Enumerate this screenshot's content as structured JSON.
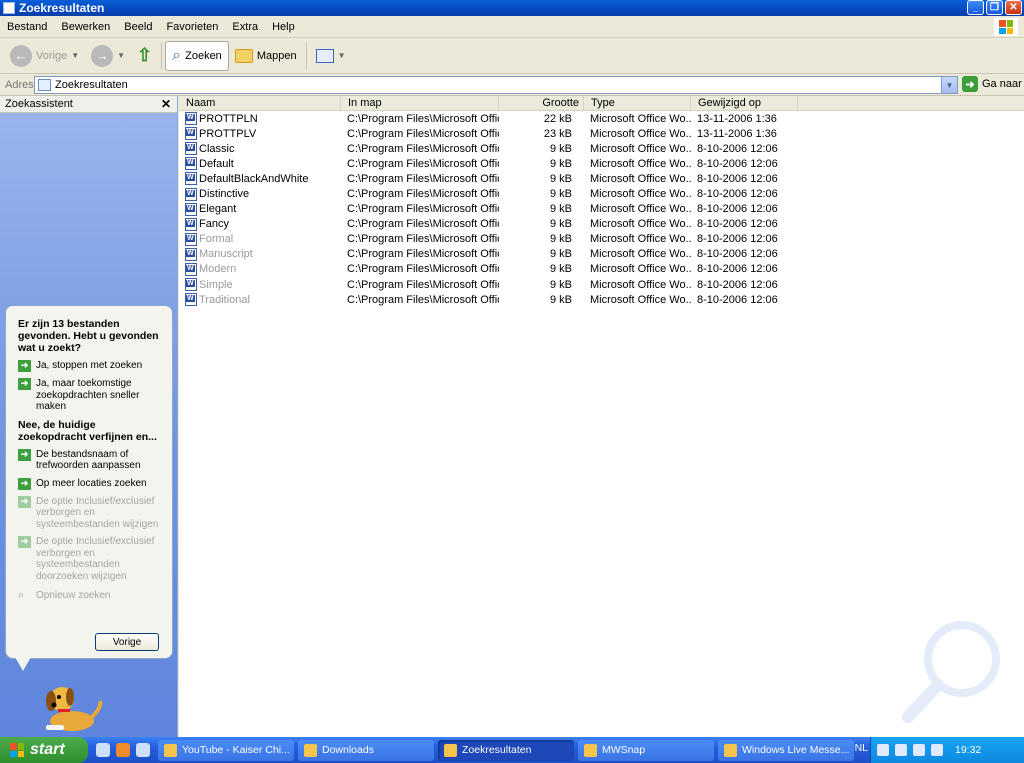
{
  "window": {
    "title": "Zoekresultaten",
    "controls": [
      "minimize",
      "maximize",
      "close"
    ]
  },
  "menu": [
    "Bestand",
    "Bewerken",
    "Beeld",
    "Favorieten",
    "Extra",
    "Help"
  ],
  "toolbar": {
    "back_label": "Vorige",
    "search_label": "Zoeken",
    "folders_label": "Mappen"
  },
  "address": {
    "label": "Adres",
    "value": "Zoekresultaten",
    "go_label": "Ga naar"
  },
  "left_pane": {
    "title": "Zoekassistent",
    "question": "Er zijn 13 bestanden gevonden. Hebt u gevonden wat u zoekt?",
    "options_yes": [
      {
        "text": "Ja, stoppen met zoeken",
        "enabled": true
      },
      {
        "text": "Ja, maar toekomstige zoekopdrachten sneller maken",
        "enabled": true
      }
    ],
    "refine_heading": "Nee, de huidige zoekopdracht verfijnen en...",
    "options_refine": [
      {
        "text": "De bestandsnaam of trefwoorden aanpassen",
        "enabled": true
      },
      {
        "text": "Op meer locaties zoeken",
        "enabled": true
      },
      {
        "text": "De optie Inclusief/exclusief verborgen en systeembestanden wijzigen",
        "enabled": false
      },
      {
        "text": "De optie Inclusief/exclusief verborgen en systeembestanden doorzoeken wijzigen",
        "enabled": false
      }
    ],
    "new_search": "Opnieuw zoeken",
    "back_button": "Vorige"
  },
  "list": {
    "columns": [
      "Naam",
      "In map",
      "Grootte",
      "Type",
      "Gewijzigd op"
    ],
    "rows": [
      {
        "name": "PROTTPLN",
        "folder": "C:\\Program Files\\Microsoft Offic...",
        "size": "22 kB",
        "type": "Microsoft Office Wo...",
        "modified": "13-11-2006 1:36",
        "faded": false
      },
      {
        "name": "PROTTPLV",
        "folder": "C:\\Program Files\\Microsoft Offic...",
        "size": "23 kB",
        "type": "Microsoft Office Wo...",
        "modified": "13-11-2006 1:36",
        "faded": false
      },
      {
        "name": "Classic",
        "folder": "C:\\Program Files\\Microsoft Offic...",
        "size": "9 kB",
        "type": "Microsoft Office Wo...",
        "modified": "8-10-2006 12:06",
        "faded": false
      },
      {
        "name": "Default",
        "folder": "C:\\Program Files\\Microsoft Offic...",
        "size": "9 kB",
        "type": "Microsoft Office Wo...",
        "modified": "8-10-2006 12:06",
        "faded": false
      },
      {
        "name": "DefaultBlackAndWhite",
        "folder": "C:\\Program Files\\Microsoft Offic...",
        "size": "9 kB",
        "type": "Microsoft Office Wo...",
        "modified": "8-10-2006 12:06",
        "faded": false
      },
      {
        "name": "Distinctive",
        "folder": "C:\\Program Files\\Microsoft Offic...",
        "size": "9 kB",
        "type": "Microsoft Office Wo...",
        "modified": "8-10-2006 12:06",
        "faded": false
      },
      {
        "name": "Elegant",
        "folder": "C:\\Program Files\\Microsoft Offic...",
        "size": "9 kB",
        "type": "Microsoft Office Wo...",
        "modified": "8-10-2006 12:06",
        "faded": false
      },
      {
        "name": "Fancy",
        "folder": "C:\\Program Files\\Microsoft Offic...",
        "size": "9 kB",
        "type": "Microsoft Office Wo...",
        "modified": "8-10-2006 12:06",
        "faded": false
      },
      {
        "name": "Formal",
        "folder": "C:\\Program Files\\Microsoft Offic...",
        "size": "9 kB",
        "type": "Microsoft Office Wo...",
        "modified": "8-10-2006 12:06",
        "faded": true
      },
      {
        "name": "Manuscript",
        "folder": "C:\\Program Files\\Microsoft Offic...",
        "size": "9 kB",
        "type": "Microsoft Office Wo...",
        "modified": "8-10-2006 12:06",
        "faded": true
      },
      {
        "name": "Modern",
        "folder": "C:\\Program Files\\Microsoft Offic...",
        "size": "9 kB",
        "type": "Microsoft Office Wo...",
        "modified": "8-10-2006 12:06",
        "faded": true
      },
      {
        "name": "Simple",
        "folder": "C:\\Program Files\\Microsoft Offic...",
        "size": "9 kB",
        "type": "Microsoft Office Wo...",
        "modified": "8-10-2006 12:06",
        "faded": true
      },
      {
        "name": "Traditional",
        "folder": "C:\\Program Files\\Microsoft Offic...",
        "size": "9 kB",
        "type": "Microsoft Office Wo...",
        "modified": "8-10-2006 12:06",
        "faded": true
      }
    ]
  },
  "taskbar": {
    "start_label": "start",
    "tasks": [
      {
        "label": "YouTube - Kaiser Chi...",
        "active": false
      },
      {
        "label": "Downloads",
        "active": false
      },
      {
        "label": "Zoekresultaten",
        "active": true
      },
      {
        "label": "MWSnap",
        "active": false
      },
      {
        "label": "Windows Live Messe...",
        "active": false
      }
    ],
    "language": "NL",
    "clock": "19:32"
  },
  "colors": {
    "titlebar": "#0548c0",
    "left_pane": "#6f93e0",
    "accent_green": "#3d9f3d",
    "taskbar": "#245edb"
  }
}
